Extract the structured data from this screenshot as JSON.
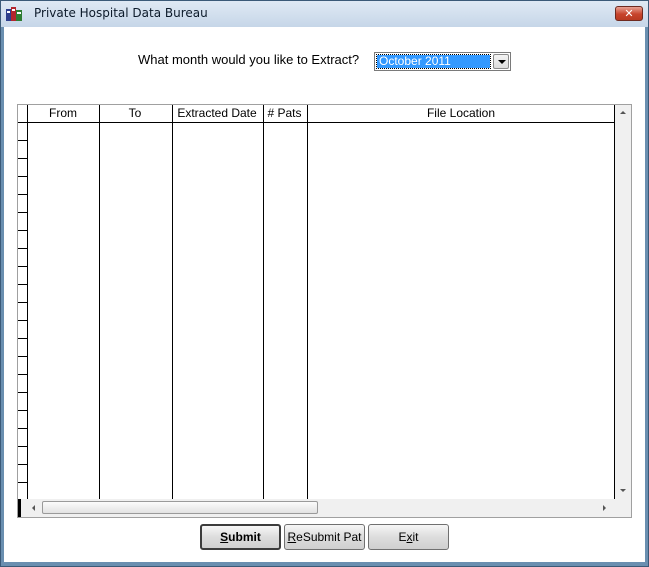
{
  "window": {
    "title": "Private Hospital Data Bureau",
    "close_label": "✕"
  },
  "extract": {
    "prompt": "What month would you like to Extract?",
    "selected_month": "October 2011"
  },
  "grid": {
    "columns": [
      "From",
      "To",
      "Extracted Date",
      "# Pats",
      "File Location"
    ],
    "rows": []
  },
  "buttons": {
    "submit": {
      "mnemonic": "S",
      "rest": "ubmit"
    },
    "resubmit": {
      "mnemonic": "R",
      "rest": "eSubmit Pat"
    },
    "exit": {
      "before": "E",
      "mnemonic": "x",
      "rest": "it"
    }
  },
  "colors": {
    "selection": "#3399ff",
    "window_frame": "#6a8fb0",
    "close_button": "#c7442c"
  },
  "icons": {
    "app": "app-icon",
    "close": "close-icon",
    "dropdown": "chevron-down-icon"
  }
}
